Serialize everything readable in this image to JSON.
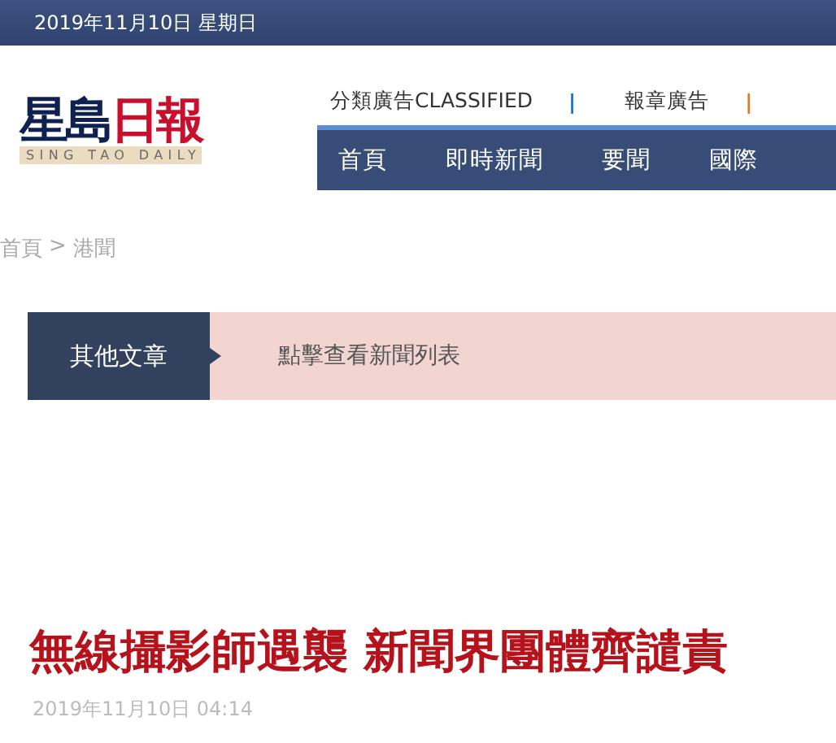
{
  "top_bar": {
    "date": "2019年11月10日 星期日"
  },
  "logo": {
    "title_dark": "星島",
    "title_red": "日報",
    "subtitle": "SING TAO DAILY"
  },
  "header_links": [
    {
      "label": "分類廣告CLASSIFIED",
      "separator": "|",
      "color": "#1a73c8"
    },
    {
      "label": "報章廣告",
      "separator": "|",
      "color": "#e07a1e"
    }
  ],
  "nav": [
    "首頁",
    "即時新聞",
    "要聞",
    "國際"
  ],
  "breadcrumb": {
    "home": "首頁",
    "sep": ">",
    "section": "港聞"
  },
  "banner": {
    "label": "其他文章",
    "link": "點擊查看新聞列表"
  },
  "article": {
    "headline": "無線攝影師遇襲 新聞界團體齊譴責",
    "timestamp": "2019年11月10日 04:14"
  }
}
